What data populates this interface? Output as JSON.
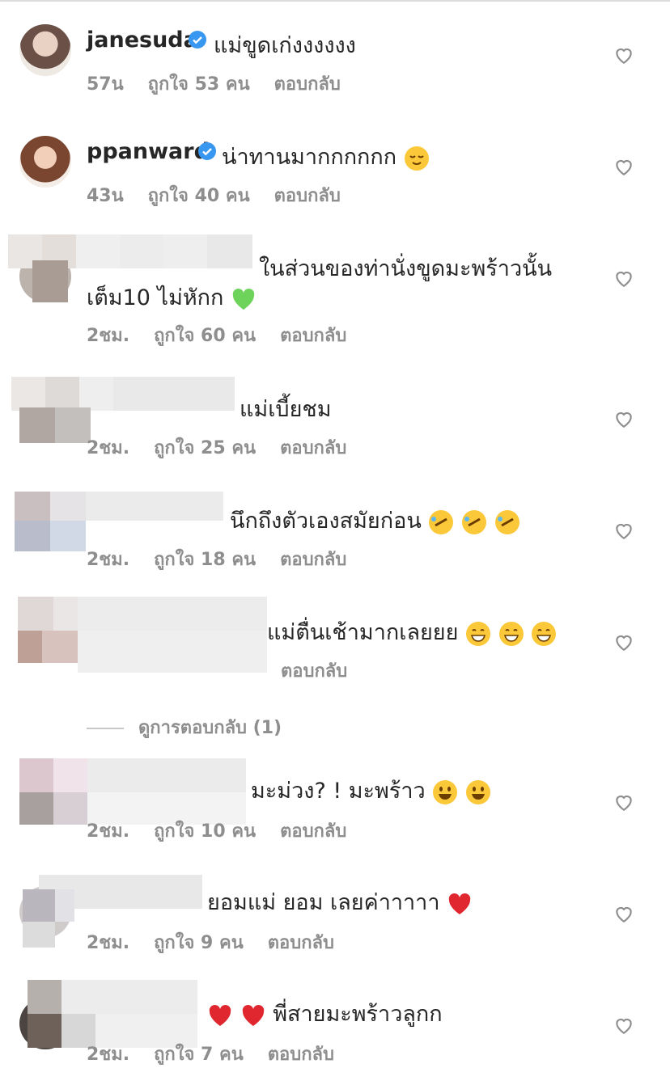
{
  "comments": [
    {
      "username": "janesuda",
      "verified": true,
      "text": "แม่ขูดเก่งงงงงง",
      "time": "57น",
      "likes": "ถูกใจ 53 คน",
      "reply": "ตอบกลับ",
      "emojis": []
    },
    {
      "username": "ppanward",
      "verified": true,
      "text": "น่าทานมากกกกกก",
      "time": "43น",
      "likes": "ถูกใจ 40 คน",
      "reply": "ตอบกลับ",
      "emojis": [
        "relieved"
      ]
    },
    {
      "username": "",
      "verified": false,
      "text": "ในส่วนของท่านั่งขูดมะพร้าวนั้น",
      "text2": "เต็ม10 ไม่หักก",
      "time": "2ชม.",
      "likes": "ถูกใจ 60 คน",
      "reply": "ตอบกลับ",
      "emojis": [
        "green-heart"
      ]
    },
    {
      "username": "",
      "verified": false,
      "text": "แม่เบี้ยชม",
      "time": "2ชม.",
      "likes": "ถูกใจ 25 คน",
      "reply": "ตอบกลับ",
      "emojis": []
    },
    {
      "username": "",
      "verified": false,
      "text": "นึกถึงตัวเองสมัยก่อน",
      "time": "2ชม.",
      "likes": "ถูกใจ 18 คน",
      "reply": "ตอบกลับ",
      "emojis": [
        "rofl",
        "rofl",
        "rofl"
      ]
    },
    {
      "username": "",
      "verified": false,
      "text": "แม่ตื่นเช้ามากเลยยย",
      "time": "",
      "likes": "",
      "reply": "ตอบกลับ",
      "emojis": [
        "grin",
        "grin",
        "grin"
      ]
    },
    {
      "username": "",
      "verified": false,
      "text": "มะม่วง? ! มะพร้าว",
      "time": "2ชม.",
      "likes": "ถูกใจ 10 คน",
      "reply": "ตอบกลับ",
      "emojis": [
        "smiley",
        "smiley"
      ]
    },
    {
      "username": "",
      "verified": false,
      "text": "ยอมแม่ ยอม เลยค่าาาาา",
      "time": "2ชม.",
      "likes": "ถูกใจ 9 คน",
      "reply": "ตอบกลับ",
      "emojis": [
        "red-heart"
      ]
    },
    {
      "username": "",
      "verified": false,
      "text": "พี่สายมะพร้าวลูกก",
      "time": "2ชม.",
      "likes": "ถูกใจ 7 คน",
      "reply": "ตอบกลับ",
      "emojis": [
        "red-heart",
        "red-heart"
      ]
    }
  ],
  "view_replies": "ดูการตอบกลับ (1)",
  "colors": {
    "text": "#262626",
    "meta": "#8e8e8e",
    "verified": "#3897f0",
    "heart": "#8e8e8e"
  }
}
